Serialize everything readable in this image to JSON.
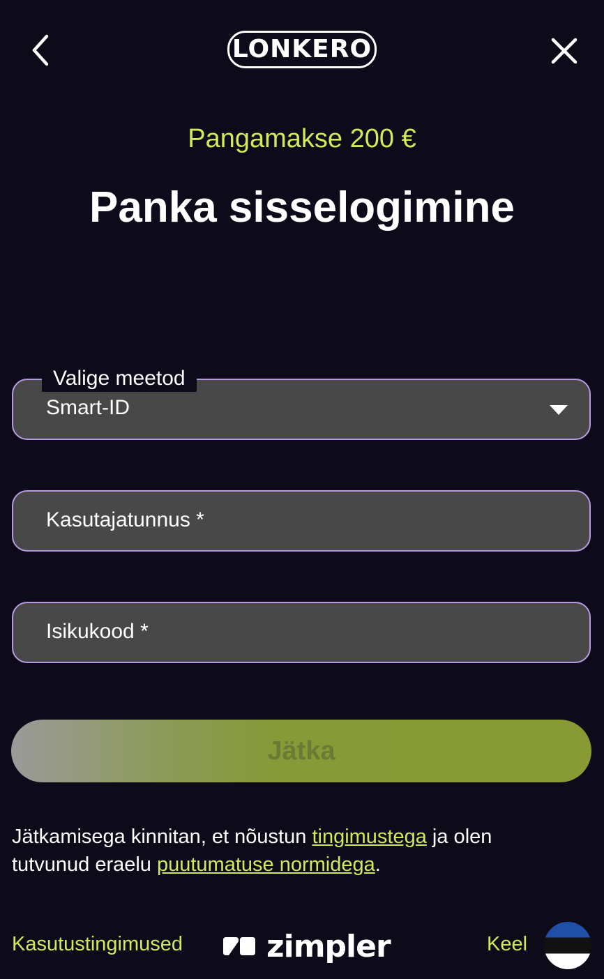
{
  "header": {
    "logo_text": "LONKERO",
    "back_icon": "chevron-left-icon",
    "close_icon": "close-icon"
  },
  "payment": {
    "amount_label": "Pangamakse 200 €"
  },
  "page": {
    "title": "Panka sisselogimine"
  },
  "form": {
    "method": {
      "label": "Valige meetod",
      "value": "Smart-ID"
    },
    "username": {
      "placeholder": "Kasutajatunnus *"
    },
    "personal_code": {
      "placeholder": "Isikukood *"
    },
    "submit_label": "Jätka"
  },
  "terms": {
    "text_1": "Jätkamisega kinnitan, et nõustun ",
    "link_1": "tingimustega",
    "text_2": " ja olen tutvunud eraelu ",
    "link_2": "puutumatuse normidega",
    "text_3": "."
  },
  "footer": {
    "terms_link": "Kasutustingimused",
    "brand": "zimpler",
    "language_label": "Keel"
  },
  "colors": {
    "background": "#0d0a1a",
    "accent": "#d4e85a",
    "field_border": "#b69be4",
    "field_bg": "#484848"
  }
}
